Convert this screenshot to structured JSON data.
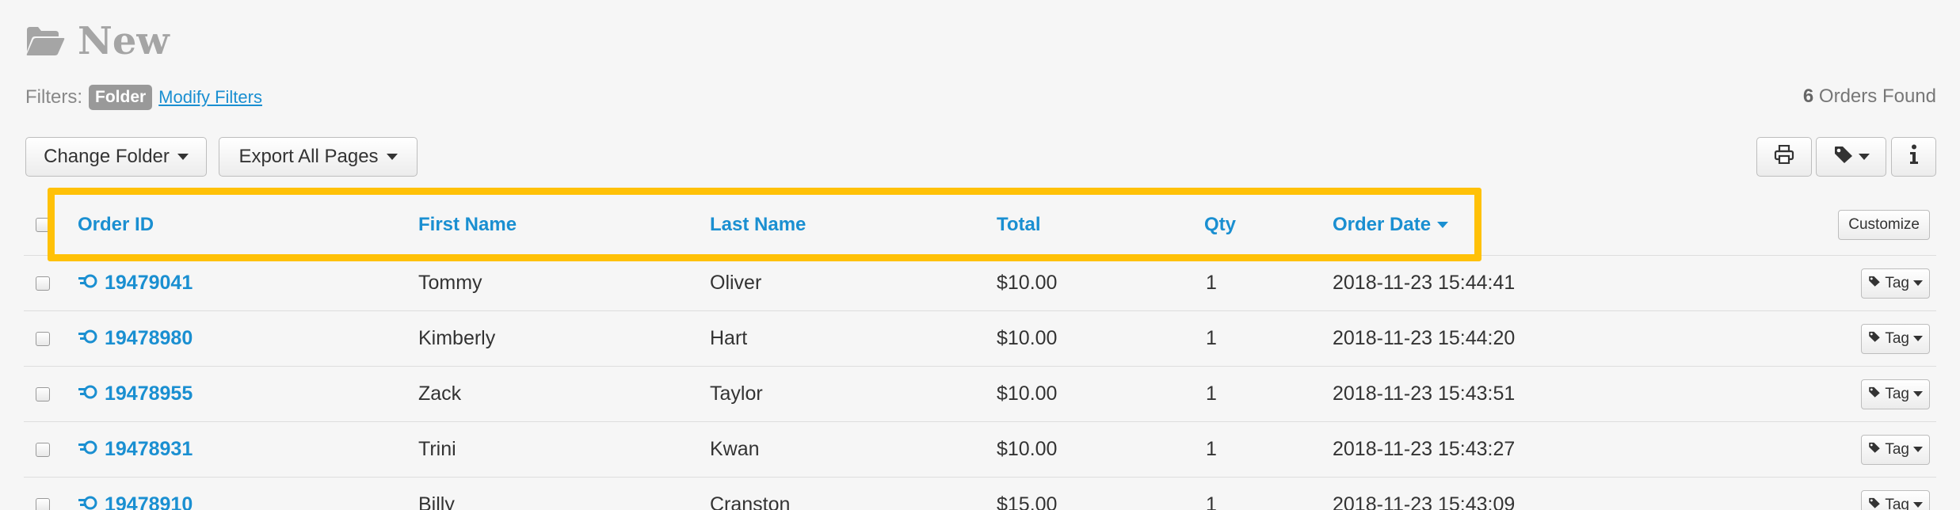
{
  "header": {
    "title": "New",
    "folder_icon": "folder-open-icon"
  },
  "filters": {
    "label": "Filters:",
    "badge": "Folder",
    "modify_link": "Modify Filters"
  },
  "results": {
    "count": "6",
    "suffix": "Orders Found"
  },
  "toolbar": {
    "change_folder": "Change Folder",
    "export_all": "Export All Pages",
    "print_icon": "printer-icon",
    "tag_icon": "tag-icon",
    "info_icon": "info-icon"
  },
  "table": {
    "columns": [
      "Order ID",
      "First Name",
      "Last Name",
      "Total",
      "Qty",
      "Order Date"
    ],
    "customize": "Customize",
    "tag_label": "Tag",
    "rows": [
      {
        "order_id": "19479041",
        "first": "Tommy",
        "last": "Oliver",
        "total": "$10.00",
        "qty": "1",
        "date": "2018-11-23 15:44:41"
      },
      {
        "order_id": "19478980",
        "first": "Kimberly",
        "last": "Hart",
        "total": "$10.00",
        "qty": "1",
        "date": "2018-11-23 15:44:20"
      },
      {
        "order_id": "19478955",
        "first": "Zack",
        "last": "Taylor",
        "total": "$10.00",
        "qty": "1",
        "date": "2018-11-23 15:43:51"
      },
      {
        "order_id": "19478931",
        "first": "Trini",
        "last": "Kwan",
        "total": "$10.00",
        "qty": "1",
        "date": "2018-11-23 15:43:27"
      },
      {
        "order_id": "19478910",
        "first": "Billy",
        "last": "Cranston",
        "total": "$15.00",
        "qty": "1",
        "date": "2018-11-23 15:43:09"
      }
    ]
  },
  "colors": {
    "link": "#1a8fd1",
    "highlight": "#ffc107"
  }
}
